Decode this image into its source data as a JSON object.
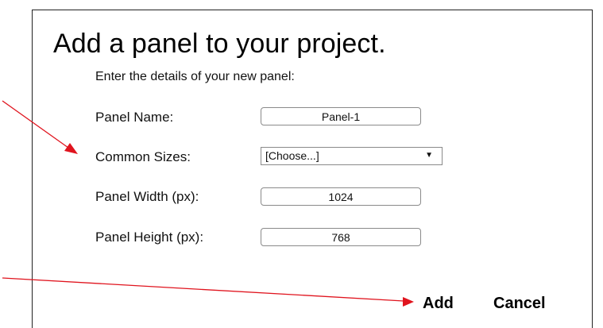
{
  "dialog": {
    "title": "Add a panel to your project.",
    "subtitle": "Enter the details of your new panel:"
  },
  "form": {
    "panel_name": {
      "label": "Panel Name:",
      "value": "Panel-1"
    },
    "common_sizes": {
      "label": "Common Sizes:",
      "selected": "[Choose...]",
      "caret": "▼"
    },
    "panel_width": {
      "label": "Panel Width (px):",
      "value": "1024"
    },
    "panel_height": {
      "label": "Panel Height (px):",
      "value": "768"
    }
  },
  "actions": {
    "add_label": "Add",
    "cancel_label": "Cancel"
  },
  "annotations": {
    "arrow_color": "#e0141e"
  }
}
